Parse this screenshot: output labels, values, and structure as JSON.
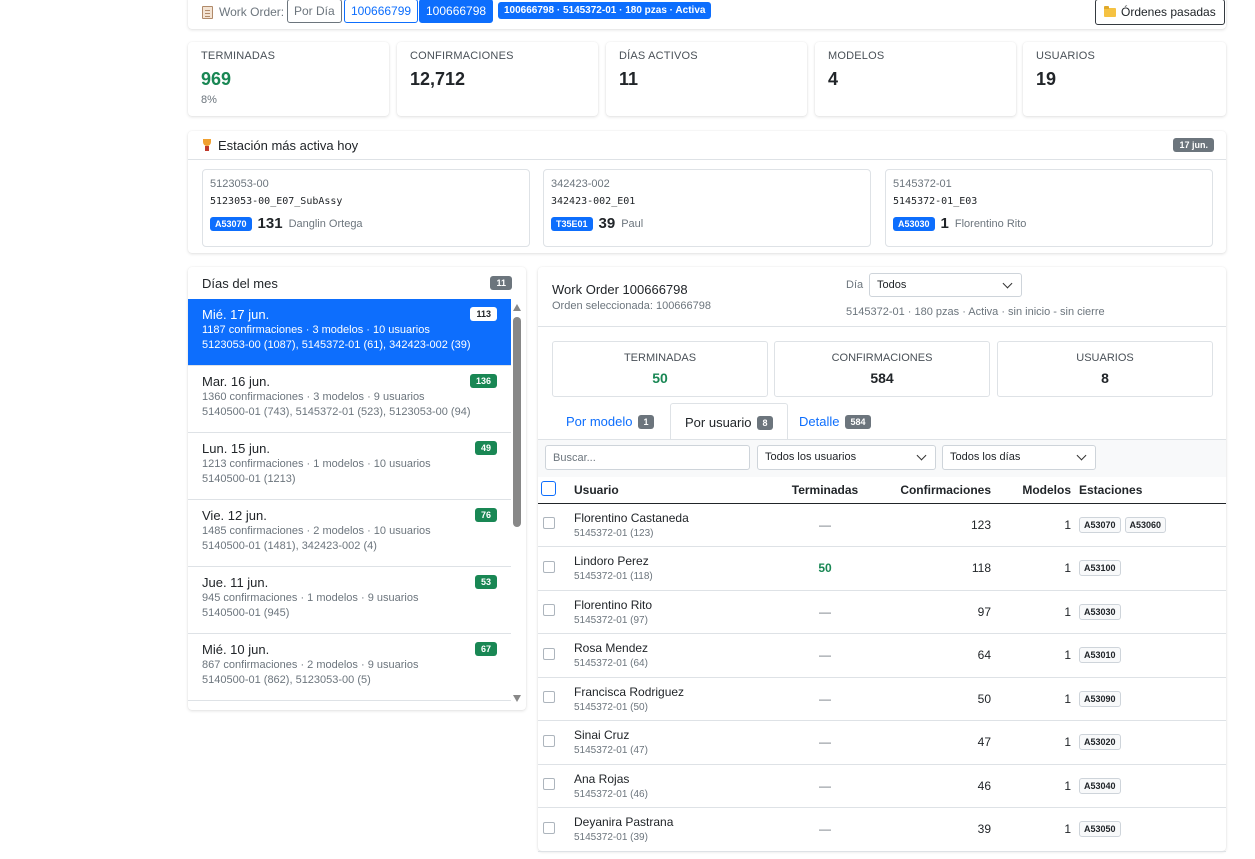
{
  "toolbar": {
    "wo_label": "Work Order:",
    "por_dia": "Por Día",
    "wo_a": "100666799",
    "wo_b": "100666798",
    "info": "100666798 · 5145372-01 · 180 pzas · Activa",
    "past_orders": "Órdenes pasadas"
  },
  "stats": [
    {
      "label": "TERMINADAS",
      "value": "969",
      "sub": "8%"
    },
    {
      "label": "CONFIRMACIONES",
      "value": "12,712"
    },
    {
      "label": "DÍAS ACTIVOS",
      "value": "11"
    },
    {
      "label": "MODELOS",
      "value": "4"
    },
    {
      "label": "USUARIOS",
      "value": "19"
    }
  ],
  "active_station": {
    "title": "Estación más activa hoy",
    "date": "17 jun.",
    "cards": [
      {
        "model": "5123053-00",
        "name": "5123053-00_E07_SubAssy",
        "station": "A53070",
        "count": "131",
        "user": "Danglin Ortega"
      },
      {
        "model": "342423-002",
        "name": "342423-002_E01",
        "station": "T35E01",
        "count": "39",
        "user": "Paul"
      },
      {
        "model": "5145372-01",
        "name": "5145372-01_E03",
        "station": "A53030",
        "count": "1",
        "user": "Florentino Rito"
      }
    ]
  },
  "days": {
    "title": "Días del mes",
    "count": "11",
    "items": [
      {
        "title": "Mié. 17 jun.",
        "meta": "1187 confirmaciones · 3 modelos · 10 usuarios",
        "models": "5123053-00 (1087), 5145372-01 (61), 342423-002 (39)",
        "badge": "113"
      },
      {
        "title": "Mar. 16 jun.",
        "meta": "1360 confirmaciones · 3 modelos · 9 usuarios",
        "models": "5140500-01 (743), 5145372-01 (523), 5123053-00 (94)",
        "badge": "136"
      },
      {
        "title": "Lun. 15 jun.",
        "meta": "1213 confirmaciones · 1 modelos · 10 usuarios",
        "models": "5140500-01 (1213)",
        "badge": "49"
      },
      {
        "title": "Vie. 12 jun.",
        "meta": "1485 confirmaciones · 2 modelos · 10 usuarios",
        "models": "5140500-01 (1481), 342423-002 (4)",
        "badge": "76"
      },
      {
        "title": "Jue. 11 jun.",
        "meta": "945 confirmaciones · 1 modelos · 9 usuarios",
        "models": "5140500-01 (945)",
        "badge": "53"
      },
      {
        "title": "Mié. 10 jun.",
        "meta": "867 confirmaciones · 2 modelos · 9 usuarios",
        "models": "5140500-01 (862), 5123053-00 (5)",
        "badge": "67"
      }
    ]
  },
  "detail": {
    "title": "Work Order 100666798",
    "subtitle": "Orden seleccionada: 100666798",
    "dia_label": "Día",
    "dia_value": "Todos",
    "meta": "5145372-01 · 180 pzas · Activa · sin inicio - sin cierre",
    "stats": [
      {
        "label": "TERMINADAS",
        "value": "50"
      },
      {
        "label": "CONFIRMACIONES",
        "value": "584"
      },
      {
        "label": "USUARIOS",
        "value": "8"
      }
    ],
    "tabs": [
      {
        "label": "Por modelo",
        "badge": "1"
      },
      {
        "label": "Por usuario",
        "badge": "8"
      },
      {
        "label": "Detalle",
        "badge": "584"
      }
    ],
    "search_placeholder": "Buscar...",
    "filter_users": "Todos los usuarios",
    "filter_days": "Todos los días",
    "columns": [
      "Usuario",
      "Terminadas",
      "Confirmaciones",
      "Modelos",
      "Estaciones"
    ],
    "rows": [
      {
        "name": "Florentino Castaneda",
        "sub": "5145372-01 (123)",
        "term": "—",
        "conf": "123",
        "models": "1",
        "stations": [
          "A53070",
          "A53060"
        ]
      },
      {
        "name": "Lindoro Perez",
        "sub": "5145372-01 (118)",
        "term": "50",
        "conf": "118",
        "models": "1",
        "stations": [
          "A53100"
        ]
      },
      {
        "name": "Florentino Rito",
        "sub": "5145372-01 (97)",
        "term": "—",
        "conf": "97",
        "models": "1",
        "stations": [
          "A53030"
        ]
      },
      {
        "name": "Rosa Mendez",
        "sub": "5145372-01 (64)",
        "term": "—",
        "conf": "64",
        "models": "1",
        "stations": [
          "A53010"
        ]
      },
      {
        "name": "Francisca Rodriguez",
        "sub": "5145372-01 (50)",
        "term": "—",
        "conf": "50",
        "models": "1",
        "stations": [
          "A53090"
        ]
      },
      {
        "name": "Sinai Cruz",
        "sub": "5145372-01 (47)",
        "term": "—",
        "conf": "47",
        "models": "1",
        "stations": [
          "A53020"
        ]
      },
      {
        "name": "Ana Rojas",
        "sub": "5145372-01 (46)",
        "term": "—",
        "conf": "46",
        "models": "1",
        "stations": [
          "A53040"
        ]
      },
      {
        "name": "Deyanira Pastrana",
        "sub": "5145372-01 (39)",
        "term": "—",
        "conf": "39",
        "models": "1",
        "stations": [
          "A53050"
        ]
      }
    ]
  }
}
